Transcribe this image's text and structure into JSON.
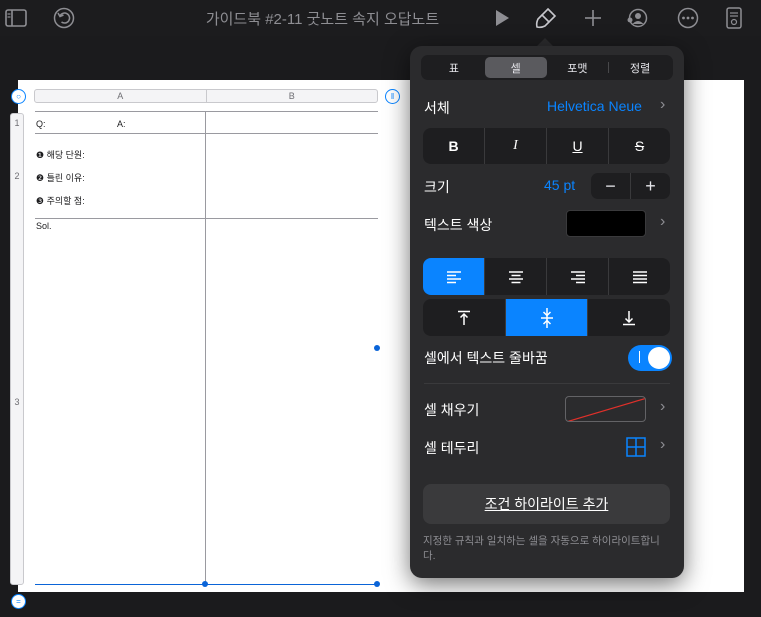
{
  "toolbar": {
    "title": "가이드북 #2-11 굿노트 속지 오답노트",
    "icons": [
      "sidebar-icon",
      "undo-icon",
      "play-icon",
      "format-brush-icon",
      "add-icon",
      "collaborate-icon",
      "more-icon",
      "document-icon"
    ]
  },
  "table": {
    "columns": [
      "A",
      "B"
    ],
    "rows": [
      "1",
      "2",
      "3"
    ],
    "cells": {
      "q": "Q:",
      "a": "A:",
      "unit": "❶ 해당 단원:",
      "reason": "❷ 틀린 이유:",
      "caution": "❸ 주의할 점:",
      "sol": "Sol."
    }
  },
  "panel": {
    "tabs": [
      "표",
      "셀",
      "포맷",
      "정렬"
    ],
    "active_tab": "셀",
    "font_label": "서체",
    "font_value": "Helvetica Neue",
    "style_buttons": [
      "B",
      "I",
      "U",
      "S"
    ],
    "size_label": "크기",
    "size_value": "45 pt",
    "stepper": [
      "−",
      "+"
    ],
    "text_color_label": "텍스트 색상",
    "text_color": "#000000",
    "wrap_label": "셀에서 텍스트 줄바꿈",
    "wrap_on": true,
    "fill_label": "셀 채우기",
    "border_label": "셀 테두리",
    "add_highlight": "조건 하이라이트 추가",
    "footnote": "지정한 규칙과 일치하는 셀을 자동으로 하이라이트합니다.",
    "accent": "#0a84ff"
  }
}
